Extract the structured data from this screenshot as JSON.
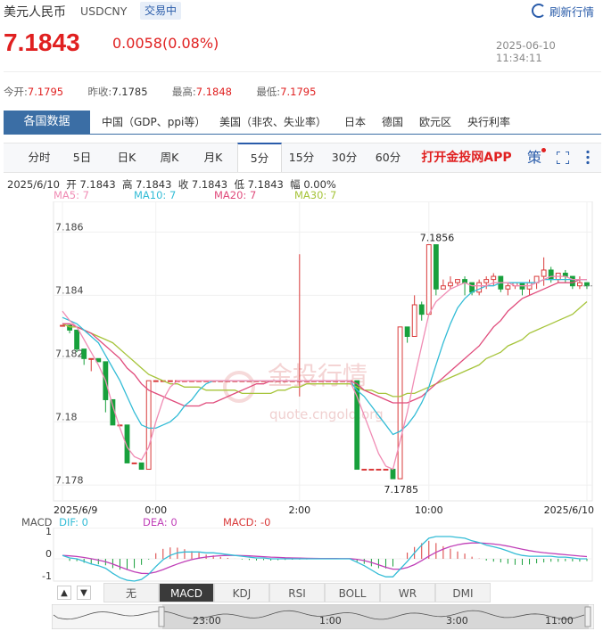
{
  "header": {
    "name": "美元人民币",
    "symbol": "USDCNY",
    "status": "交易中",
    "refresh_label": "刷新行情",
    "price": "7.1843",
    "change": "0.0058(0.08%)",
    "datetime": "2025-06-10 11:34:11"
  },
  "stats": {
    "open_label": "今开:",
    "open": "7.1795",
    "prev_label": "昨收:",
    "prev": "7.1785",
    "high_label": "最高:",
    "high": "7.1848",
    "low_label": "最低:",
    "low": "7.1795"
  },
  "data_tabs": {
    "main": "各国数据",
    "items": [
      "中国（GDP、ppi等）",
      "美国（非农、失业率）",
      "日本",
      "德国",
      "欧元区",
      "央行利率"
    ]
  },
  "periods": {
    "items": [
      "分时",
      "5日",
      "日K",
      "周K",
      "月K",
      "5分",
      "15分",
      "30分",
      "60分"
    ],
    "active": "5分",
    "app_link": "打开金投网APP",
    "ce": "策"
  },
  "ohlc": {
    "date": "2025/6/10",
    "open_label": "开",
    "open": "7.1843",
    "high_label": "高",
    "high": "7.1843",
    "close_label": "收",
    "close": "7.1843",
    "low_label": "低",
    "low": "7.1843",
    "amp_label": "幅",
    "amp": "0.00%"
  },
  "ma_legend": {
    "ma5": "MA5: 7",
    "ma10": "MA10: 7",
    "ma20": "MA20: 7",
    "ma30": "MA30: 7"
  },
  "colors": {
    "up": "#d93a3a",
    "down": "#18a03c",
    "ma5": "#f08cb4",
    "ma10": "#33bcd6",
    "ma20": "#e04c7c",
    "ma30": "#a6c43a",
    "dif": "#33bcd6",
    "dea": "#c040b8"
  },
  "watermark": {
    "brand": "金投行情",
    "url": "quote.cngold.org"
  },
  "chart_data": {
    "type": "candlestick",
    "y_ticks": [
      "7.186",
      "7.184",
      "7.182",
      "7.18",
      "7.178"
    ],
    "ylim": [
      7.1775,
      7.1868
    ],
    "x_ticks": [
      "2025/6/9",
      "0:00",
      "2:00",
      "10:00",
      "2025/6/10"
    ],
    "annotations": {
      "max": "7.1856",
      "min": "7.1785"
    },
    "candles": [
      {
        "o": 7.18305,
        "h": 7.18305,
        "c": 7.18305,
        "l": 7.18305
      },
      {
        "o": 7.18305,
        "h": 7.18305,
        "c": 7.1829,
        "l": 7.1828
      },
      {
        "o": 7.1829,
        "h": 7.1829,
        "c": 7.1823,
        "l": 7.1822
      },
      {
        "o": 7.1823,
        "h": 7.1823,
        "c": 7.182,
        "l": 7.1818
      },
      {
        "o": 7.182,
        "h": 7.182,
        "c": 7.182,
        "l": 7.1816
      },
      {
        "o": 7.182,
        "h": 7.182,
        "c": 7.1819,
        "l": 7.1819
      },
      {
        "o": 7.1819,
        "h": 7.1819,
        "c": 7.1807,
        "l": 7.1803
      },
      {
        "o": 7.1807,
        "h": 7.1807,
        "c": 7.1799,
        "l": 7.1799
      },
      {
        "o": 7.1799,
        "h": 7.1799,
        "c": 7.1799,
        "l": 7.1799
      },
      {
        "o": 7.1799,
        "h": 7.1799,
        "c": 7.1787,
        "l": 7.1787
      },
      {
        "o": 7.1787,
        "h": 7.1787,
        "c": 7.1787,
        "l": 7.1787
      },
      {
        "o": 7.1787,
        "h": 7.1787,
        "c": 7.1785,
        "l": 7.1785
      },
      {
        "o": 7.1785,
        "h": 7.1813,
        "c": 7.1813,
        "l": 7.1785
      },
      {
        "o": 7.1813,
        "h": 7.1813,
        "c": 7.1813,
        "l": 7.1813
      },
      {
        "o": 7.1813,
        "h": 7.1813,
        "c": 7.1813,
        "l": 7.1813
      },
      {
        "o": 7.1813,
        "h": 7.1813,
        "c": 7.1813,
        "l": 7.1813
      },
      {
        "o": 7.1813,
        "h": 7.1813,
        "c": 7.1813,
        "l": 7.1813
      },
      {
        "o": 7.1813,
        "h": 7.1813,
        "c": 7.1813,
        "l": 7.1813
      },
      {
        "o": 7.1813,
        "h": 7.1813,
        "c": 7.1813,
        "l": 7.1813
      },
      {
        "o": 7.1813,
        "h": 7.1813,
        "c": 7.1813,
        "l": 7.1813
      },
      {
        "o": 7.1813,
        "h": 7.1813,
        "c": 7.1813,
        "l": 7.1813
      },
      {
        "o": 7.1813,
        "h": 7.1813,
        "c": 7.1813,
        "l": 7.1813
      },
      {
        "o": 7.1813,
        "h": 7.1813,
        "c": 7.1813,
        "l": 7.1813
      },
      {
        "o": 7.1813,
        "h": 7.1813,
        "c": 7.1813,
        "l": 7.1813
      },
      {
        "o": 7.1813,
        "h": 7.1813,
        "c": 7.1813,
        "l": 7.1813
      },
      {
        "o": 7.1813,
        "h": 7.1813,
        "c": 7.1813,
        "l": 7.1813
      },
      {
        "o": 7.1813,
        "h": 7.1813,
        "c": 7.1813,
        "l": 7.1813
      },
      {
        "o": 7.1813,
        "h": 7.1813,
        "c": 7.1813,
        "l": 7.1813
      },
      {
        "o": 7.1813,
        "h": 7.1813,
        "c": 7.1813,
        "l": 7.1813
      },
      {
        "o": 7.1813,
        "h": 7.1813,
        "c": 7.1813,
        "l": 7.1813
      },
      {
        "o": 7.1813,
        "h": 7.1813,
        "c": 7.1813,
        "l": 7.1813
      },
      {
        "o": 7.1813,
        "h": 7.1813,
        "c": 7.1813,
        "l": 7.1813
      },
      {
        "o": 7.1813,
        "h": 7.1813,
        "c": 7.1813,
        "l": 7.1813
      },
      {
        "o": 7.1813,
        "h": 7.1853,
        "c": 7.1813,
        "l": 7.1808
      },
      {
        "o": 7.1813,
        "h": 7.1813,
        "c": 7.1813,
        "l": 7.1813
      },
      {
        "o": 7.1813,
        "h": 7.1813,
        "c": 7.1813,
        "l": 7.1813
      },
      {
        "o": 7.1813,
        "h": 7.1813,
        "c": 7.1813,
        "l": 7.1813
      },
      {
        "o": 7.1813,
        "h": 7.1813,
        "c": 7.1813,
        "l": 7.1813
      },
      {
        "o": 7.1813,
        "h": 7.1813,
        "c": 7.1813,
        "l": 7.1813
      },
      {
        "o": 7.1813,
        "h": 7.1813,
        "c": 7.1813,
        "l": 7.1813
      },
      {
        "o": 7.1813,
        "h": 7.1813,
        "c": 7.1813,
        "l": 7.1813
      },
      {
        "o": 7.1813,
        "h": 7.1813,
        "c": 7.1785,
        "l": 7.1785
      },
      {
        "o": 7.1785,
        "h": 7.1785,
        "c": 7.1785,
        "l": 7.1785
      },
      {
        "o": 7.1785,
        "h": 7.1785,
        "c": 7.1785,
        "l": 7.1785
      },
      {
        "o": 7.1785,
        "h": 7.1785,
        "c": 7.1785,
        "l": 7.1785
      },
      {
        "o": 7.1785,
        "h": 7.1785,
        "c": 7.1785,
        "l": 7.1785
      },
      {
        "o": 7.1785,
        "h": 7.1785,
        "c": 7.1782,
        "l": 7.1782
      },
      {
        "o": 7.1782,
        "h": 7.183,
        "c": 7.183,
        "l": 7.1782
      },
      {
        "o": 7.183,
        "h": 7.183,
        "c": 7.1827,
        "l": 7.1825
      },
      {
        "o": 7.1827,
        "h": 7.184,
        "c": 7.1837,
        "l": 7.1827
      },
      {
        "o": 7.1837,
        "h": 7.1838,
        "c": 7.1834,
        "l": 7.1832
      },
      {
        "o": 7.1834,
        "h": 7.1856,
        "c": 7.1856,
        "l": 7.1834
      },
      {
        "o": 7.1856,
        "h": 7.1856,
        "c": 7.1842,
        "l": 7.184
      },
      {
        "o": 7.1842,
        "h": 7.1845,
        "c": 7.1843,
        "l": 7.1842
      },
      {
        "o": 7.1843,
        "h": 7.1846,
        "c": 7.1844,
        "l": 7.1842
      },
      {
        "o": 7.1844,
        "h": 7.1845,
        "c": 7.1845,
        "l": 7.1843
      },
      {
        "o": 7.1845,
        "h": 7.1846,
        "c": 7.1844,
        "l": 7.184
      },
      {
        "o": 7.1844,
        "h": 7.1844,
        "c": 7.1841,
        "l": 7.184
      },
      {
        "o": 7.1841,
        "h": 7.1845,
        "c": 7.1844,
        "l": 7.184
      },
      {
        "o": 7.1844,
        "h": 7.1846,
        "c": 7.1845,
        "l": 7.1842
      },
      {
        "o": 7.1845,
        "h": 7.1847,
        "c": 7.1846,
        "l": 7.1843
      },
      {
        "o": 7.1846,
        "h": 7.1846,
        "c": 7.1842,
        "l": 7.1841
      },
      {
        "o": 7.1842,
        "h": 7.1844,
        "c": 7.1843,
        "l": 7.184
      },
      {
        "o": 7.1843,
        "h": 7.1844,
        "c": 7.1844,
        "l": 7.1842
      },
      {
        "o": 7.1844,
        "h": 7.1844,
        "c": 7.1842,
        "l": 7.184
      },
      {
        "o": 7.1842,
        "h": 7.1845,
        "c": 7.1844,
        "l": 7.184
      },
      {
        "o": 7.1844,
        "h": 7.1846,
        "c": 7.1846,
        "l": 7.1842
      },
      {
        "o": 7.1846,
        "h": 7.1852,
        "c": 7.1848,
        "l": 7.1843
      },
      {
        "o": 7.1848,
        "h": 7.1849,
        "c": 7.1845,
        "l": 7.1844
      },
      {
        "o": 7.1845,
        "h": 7.1847,
        "c": 7.1847,
        "l": 7.1844
      },
      {
        "o": 7.1847,
        "h": 7.1848,
        "c": 7.1846,
        "l": 7.1844
      },
      {
        "o": 7.1846,
        "h": 7.1846,
        "c": 7.1843,
        "l": 7.1842
      },
      {
        "o": 7.1843,
        "h": 7.1846,
        "c": 7.1844,
        "l": 7.1842
      },
      {
        "o": 7.1844,
        "h": 7.1844,
        "c": 7.1843,
        "l": 7.1842
      }
    ],
    "ma5": [
      7.1835,
      7.1832,
      7.183,
      7.1826,
      7.1822,
      7.1818,
      7.1813,
      7.1805,
      7.1798,
      7.1792,
      7.1789,
      7.1788,
      7.1792,
      7.18,
      7.1807,
      7.1811,
      7.1813,
      7.1813,
      7.1813,
      7.1813,
      7.1813,
      7.1813,
      7.1813,
      7.1813,
      7.1813,
      7.1813,
      7.1813,
      7.1813,
      7.1813,
      7.1813,
      7.1813,
      7.1813,
      7.1813,
      7.1813,
      7.1813,
      7.1813,
      7.1813,
      7.1813,
      7.1813,
      7.1813,
      7.1813,
      7.1808,
      7.1802,
      7.1796,
      7.179,
      7.1786,
      7.1785,
      7.1794,
      7.1803,
      7.1814,
      7.1824,
      7.1834,
      7.1838,
      7.184,
      7.1842,
      7.1843,
      7.1844,
      7.1843,
      7.1843,
      7.1843,
      7.1844,
      7.1844,
      7.1844,
      7.1843,
      7.1843,
      7.1843,
      7.1844,
      7.1845,
      7.1846,
      7.1846,
      7.1846,
      7.1845,
      7.1845,
      7.1845
    ],
    "ma10": [
      7.1833,
      7.1832,
      7.1831,
      7.1829,
      7.1827,
      7.1825,
      7.1821,
      7.1817,
      7.1813,
      7.1808,
      7.1803,
      7.1799,
      7.1798,
      7.1798,
      7.1799,
      7.18,
      7.1802,
      7.1805,
      7.1807,
      7.181,
      7.1812,
      7.1813,
      7.1813,
      7.1813,
      7.1813,
      7.1813,
      7.1813,
      7.1813,
      7.1813,
      7.1813,
      7.1813,
      7.1813,
      7.1813,
      7.1813,
      7.1813,
      7.1813,
      7.1813,
      7.1813,
      7.1813,
      7.1813,
      7.1813,
      7.181,
      7.1808,
      7.1805,
      7.1802,
      7.1799,
      7.1796,
      7.1797,
      7.1799,
      7.1802,
      7.1806,
      7.1811,
      7.1818,
      7.1825,
      7.1831,
      7.1836,
      7.1839,
      7.1841,
      7.1842,
      7.1843,
      7.1843,
      7.1844,
      7.1844,
      7.1844,
      7.1844,
      7.1844,
      7.1844,
      7.1845,
      7.1845,
      7.1845,
      7.1845,
      7.1845,
      7.1845,
      7.1845
    ],
    "ma20": [
      7.1831,
      7.1831,
      7.183,
      7.1829,
      7.1828,
      7.1826,
      7.1824,
      7.1822,
      7.182,
      7.1817,
      7.1815,
      7.1812,
      7.181,
      7.1809,
      7.1808,
      7.1807,
      7.1806,
      7.1805,
      7.1805,
      7.1805,
      7.1806,
      7.1806,
      7.1807,
      7.1808,
      7.1809,
      7.181,
      7.1811,
      7.1812,
      7.1812,
      7.1813,
      7.1813,
      7.1813,
      7.1813,
      7.1813,
      7.1813,
      7.1813,
      7.1813,
      7.1813,
      7.1813,
      7.1813,
      7.1813,
      7.1812,
      7.181,
      7.1809,
      7.1808,
      7.1807,
      7.1806,
      7.1806,
      7.1806,
      7.1807,
      7.1808,
      7.181,
      7.1812,
      7.1814,
      7.1816,
      7.1818,
      7.182,
      7.1822,
      7.1824,
      7.1827,
      7.183,
      7.1832,
      7.1835,
      7.1837,
      7.1839,
      7.184,
      7.1841,
      7.1842,
      7.1843,
      7.1844,
      7.1844,
      7.1844,
      7.1845,
      7.1845
    ],
    "ma30": [
      7.1831,
      7.183,
      7.183,
      7.1829,
      7.1828,
      7.1827,
      7.1826,
      7.1825,
      7.1823,
      7.1821,
      7.1819,
      7.1817,
      7.1815,
      7.1814,
      7.1813,
      7.1812,
      7.1812,
      7.1811,
      7.1811,
      7.1811,
      7.181,
      7.181,
      7.181,
      7.181,
      7.181,
      7.1809,
      7.1809,
      7.1809,
      7.1809,
      7.1809,
      7.181,
      7.181,
      7.1811,
      7.1811,
      7.1812,
      7.1812,
      7.1812,
      7.1812,
      7.1812,
      7.1812,
      7.1812,
      7.1811,
      7.181,
      7.181,
      7.1809,
      7.1809,
      7.1808,
      7.1808,
      7.1809,
      7.1809,
      7.181,
      7.1811,
      7.1812,
      7.1813,
      7.1814,
      7.1815,
      7.1816,
      7.1817,
      7.1818,
      7.182,
      7.1821,
      7.1822,
      7.1824,
      7.1825,
      7.1826,
      7.1828,
      7.1829,
      7.183,
      7.1831,
      7.1832,
      7.1833,
      7.1834,
      7.1836,
      7.1838
    ]
  },
  "macd": {
    "label": "MACD",
    "dif_label": "DIF: 0",
    "dea_label": "DEA: 0",
    "macd_label": "MACD: -0",
    "y_ticks": [
      "1",
      "0",
      "-1"
    ]
  },
  "indicator_tabs": {
    "items": [
      "无",
      "MACD",
      "KDJ",
      "RSI",
      "BOLL",
      "WR",
      "DMI"
    ],
    "active": "MACD",
    "up_arrow": "▲",
    "down_arrow": "▼"
  },
  "navigator": {
    "ticks": [
      "23:00",
      "1:00",
      "3:00",
      "11:00"
    ]
  }
}
